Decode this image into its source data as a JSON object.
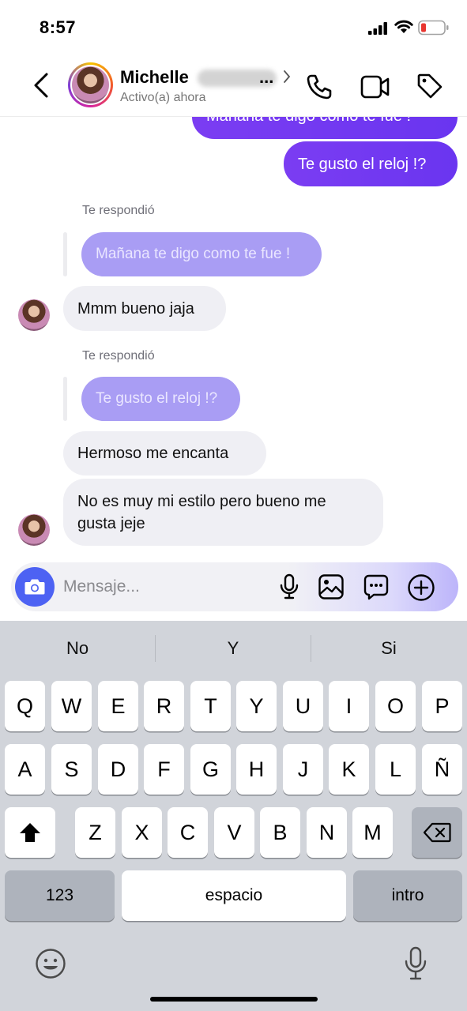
{
  "status_bar": {
    "time": "8:57"
  },
  "header": {
    "contact_name": "Michelle",
    "name_truncation": "...",
    "contact_status": "Activo(a) ahora"
  },
  "messages": {
    "sent_partial": "Mañana te digo como te fue !",
    "sent_question": "Te gusto el reloj !?",
    "reply_label_1": "Te respondió",
    "reply_quote_1": "Mañana te digo como te fue !",
    "received_1": "Mmm bueno jaja",
    "reply_label_2": "Te respondió",
    "reply_quote_2": "Te gusto el reloj !?",
    "received_2": "Hermoso me encanta",
    "received_3_line1": "No es muy mi estilo pero bueno me",
    "received_3_line2": "gusta jeje"
  },
  "composer": {
    "placeholder": "Mensaje..."
  },
  "keyboard": {
    "suggestions": [
      "No",
      "Y",
      "Si"
    ],
    "row1": [
      "Q",
      "W",
      "E",
      "R",
      "T",
      "Y",
      "U",
      "I",
      "O",
      "P"
    ],
    "row2": [
      "A",
      "S",
      "D",
      "F",
      "G",
      "H",
      "J",
      "K",
      "L",
      "Ñ"
    ],
    "row3": [
      "Z",
      "X",
      "C",
      "V",
      "B",
      "N",
      "M"
    ],
    "numbers_key": "123",
    "space_key": "espacio",
    "return_key": "intro"
  },
  "colors": {
    "sent_bubble": "#6a35f0",
    "reply_bubble": "#a99df4",
    "received_bubble": "#efeff4",
    "camera_button": "#4d62f3",
    "battery_low": "#e8352f"
  },
  "icons": [
    "back-icon",
    "phone-icon",
    "video-camera-icon",
    "tag-icon",
    "camera-icon",
    "microphone-icon",
    "gallery-icon",
    "sticker-icon",
    "plus-icon",
    "shift-icon",
    "delete-icon",
    "emoji-icon",
    "dictation-icon"
  ]
}
